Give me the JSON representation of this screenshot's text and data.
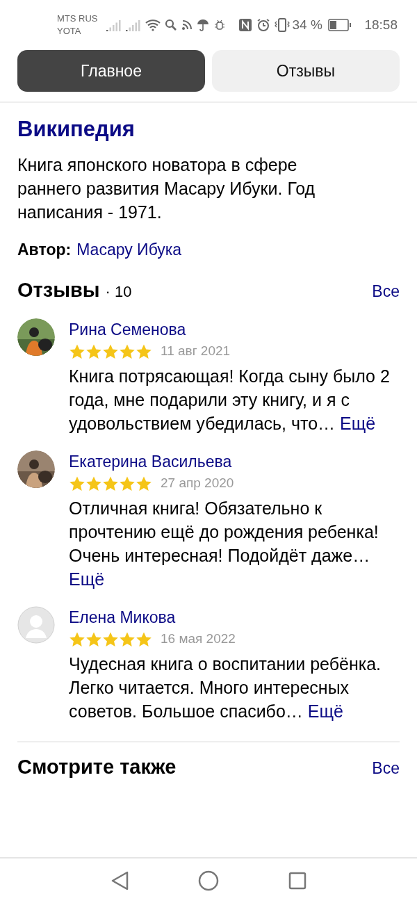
{
  "status_bar": {
    "carrier_1": "MTS RUS",
    "carrier_2": "YOTA",
    "battery": "34 %",
    "time": "18:58"
  },
  "tabs": [
    {
      "label": "Главное",
      "selected": true
    },
    {
      "label": "Отзывы",
      "selected": false
    }
  ],
  "wikipedia": {
    "title": "Википедия",
    "description": "Книга японского новатора в сфере раннего развития Масару Ибуки. Год написания - 1971.",
    "author_label": "Автор:",
    "author": "Масару Ибука"
  },
  "reviews": {
    "title": "Отзывы",
    "count": "· 10",
    "all_link": "Все",
    "items": [
      {
        "kind": "picture",
        "name": "Рина Семенова",
        "stars": 5,
        "date": "11 авг 2021",
        "text": "Книга потрясающая! Когда сыну было 2 года, мне подарили эту книгу, и я с удовольствием убедилась, что…",
        "more": "Ещё"
      },
      {
        "kind": "picture",
        "name": "Екатерина Васильева",
        "stars": 5,
        "date": "27 апр 2020",
        "text": "Отличная книга! Обязательно к прочтению ещё до рождения ребенка! Очень интересная! Подойдёт даже…",
        "more": "Ещё"
      },
      {
        "kind": "placeholder",
        "name": "Елена Микова",
        "stars": 5,
        "date": "16 мая 2022",
        "text": "Чудесная книга о воспитании ребёнка. Легко читается. Много интересных советов. Большое спасибо…",
        "more": "Ещё"
      }
    ]
  },
  "see_also": {
    "title": "Смотрите также",
    "all_link": "Все"
  }
}
